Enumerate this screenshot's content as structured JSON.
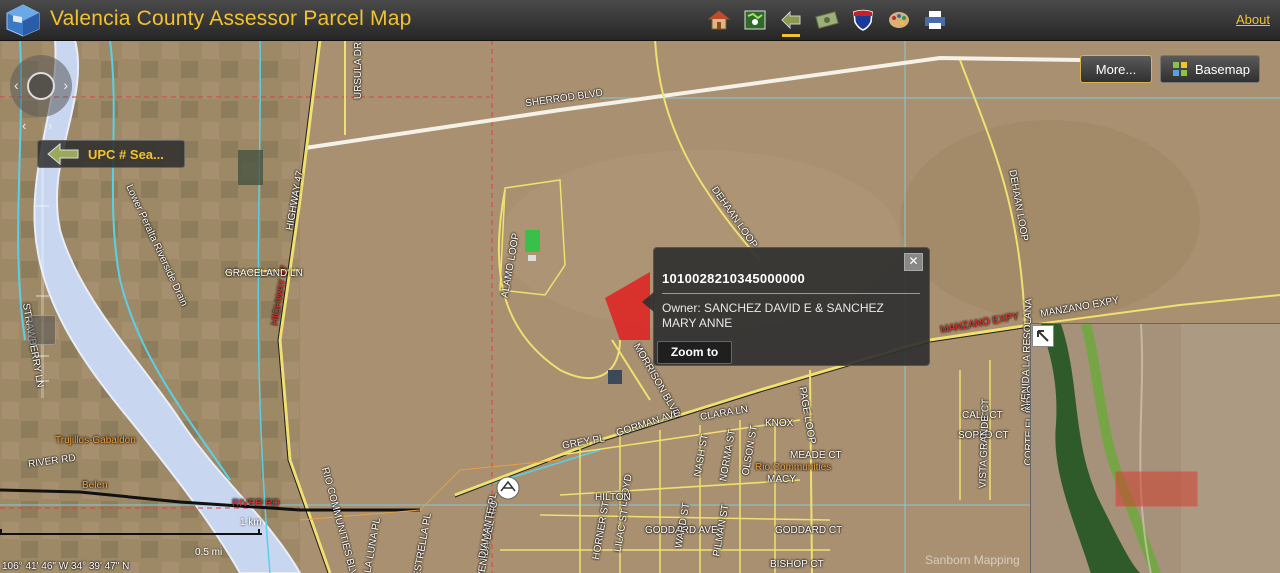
{
  "header": {
    "title": "Valencia County Assessor Parcel Map",
    "about_label": "About",
    "tools": [
      {
        "name": "home-tool",
        "icon": "house-icon"
      },
      {
        "name": "parcel-search-tool",
        "icon": "map-search-icon"
      },
      {
        "name": "upc-search-tool",
        "icon": "parcel-arrows-icon",
        "active": true
      },
      {
        "name": "owner-search-tool",
        "icon": "money-icon"
      },
      {
        "name": "interstate-tool",
        "icon": "interstate-shield-icon"
      },
      {
        "name": "palette-tool",
        "icon": "palette-icon"
      },
      {
        "name": "print-tool",
        "icon": "printer-icon"
      }
    ]
  },
  "controls": {
    "more_label": "More...",
    "basemap_label": "Basemap",
    "upc_search_label": "UPC # Sea..."
  },
  "popup": {
    "parcel_id": "1010028210345000000",
    "owner": "Owner: SANCHEZ DAVID E & SANCHEZ MARY ANNE",
    "zoom_label": "Zoom to",
    "close_label": "✕"
  },
  "map_labels": {
    "sherrod_blvd": "SHERROD BLVD",
    "ursula_dr": "URSULA DR",
    "highway_47": "HIGHWAY 47",
    "highway_47_red": "HIGHWAY 47",
    "graceland_ln": "GRACELAND LN",
    "alamo_loop": "ALAMO LOOP",
    "dehaan_loop_1": "DEHAAN LOOP",
    "dehaan_loop_2": "DEHAAN LOOP",
    "manzano_expy": "MANZANO EXPY",
    "manzano_expy_red": "MANZANO EXPY",
    "morrison_blvd": "MORRISON BLVD",
    "gorman_ave": "GORMAN AVE",
    "clara_ln": "CLARA LN",
    "grey_pl": "GREY PL",
    "knox": "KNOX",
    "meade_ct": "MEADE CT",
    "macy": "MACY",
    "lloyd": "LLOYD",
    "nash_st": "NASH ST",
    "norma_st": "NORMA ST",
    "olson_st": "OLSON ST",
    "communities_orange": "Rio Communities",
    "pagemaker": "PAGE LOOP",
    "hilton": "HILTON",
    "goddard_ave": "GODDARD AVE",
    "goddard_ct": "GODDARD CT",
    "bishop_ct": "BISHOP CT",
    "river_rd": "RIVER RD",
    "river_rd_red": "RIVER RD",
    "rio_communities_blvd": "RIO COMMUNITIES BLVD",
    "strawberry_ln": "STRAWBERRY LN",
    "trujillos_gabaldon": "Trujillos-Gabaldon",
    "belen": "Belen",
    "call_ct": "CALL CT",
    "soplo_ct": "SOPLO CT",
    "vista_grande_ct": "VISTA GRANDE CT",
    "avenida_la_resolana": "AVENIDA LA RESOLANA",
    "corte_el_indio": "CORTE EL INDIO",
    "lower_peralta": "Lower Peralta Riverside Drain",
    "avenida_del_rio": "AVENIDA DEL RIO",
    "la_luna": "LA LUNA PL",
    "strella": "ESTRELLA PL",
    "diamante": "DIAMANTE PL",
    "horner": "HORNER ST",
    "lilac": "LILAC ST",
    "ward": "WARD ST",
    "pilman": "PILMAN ST"
  },
  "scale": {
    "km": "1 km",
    "mi": "0.5 mi"
  },
  "coordinates": "106° 41' 46\" W 34° 39' 47\" N",
  "credit": "Sanborn Mapping"
}
